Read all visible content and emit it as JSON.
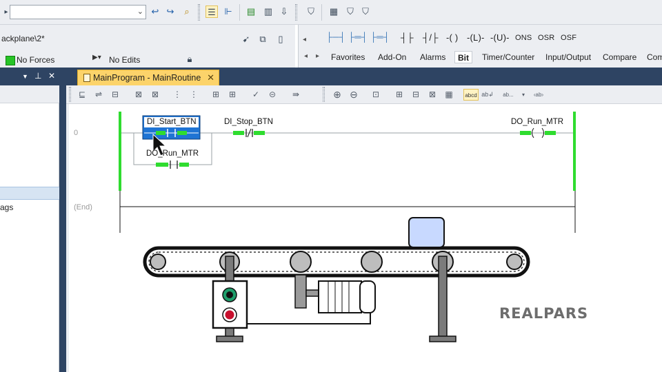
{
  "toolbar": {
    "combo_value": "",
    "icons": [
      "go-to-icon",
      "find-icon",
      "search-icon",
      "verify-icon",
      "tree-icon",
      "routine-icon",
      "doc-check-icon",
      "doc-icon",
      "download-icon",
      "shield-icon",
      "folders-icon",
      "shield-add-icon",
      "shield-gear-icon"
    ]
  },
  "controller": {
    "path": "ackplane\\2*",
    "forces": "No Forces",
    "edits": "No Edits"
  },
  "palette": {
    "instructions": [
      "ONS",
      "OSR",
      "OSF"
    ],
    "tabs": [
      "Favorites",
      "Add-On",
      "Alarms",
      "Bit",
      "Timer/Counter",
      "Input/Output",
      "Compare",
      "Com"
    ],
    "active_tab": "Bit"
  },
  "left_pane": {
    "tags_label": "ags"
  },
  "editor": {
    "tab_title": "MainProgram - MainRoutine",
    "toolbar_text": "ab..."
  },
  "ladder": {
    "rung_number": "0",
    "end_label": "(End)",
    "start_tag": "DI_Start_BTN",
    "stop_tag": "DI_Stop_BTN",
    "seal_tag": "DO_Run_MTR",
    "coil_tag": "DO_Run_MTR"
  },
  "logo": {
    "text": "REALPARS"
  },
  "colors": {
    "accent_dark": "#2e4463",
    "tab_active": "#fcd36a",
    "power_rail": "#2fdc2f",
    "selection": "#1f74d4",
    "button_green": "#1f9e6b",
    "button_red": "#c8102e"
  }
}
